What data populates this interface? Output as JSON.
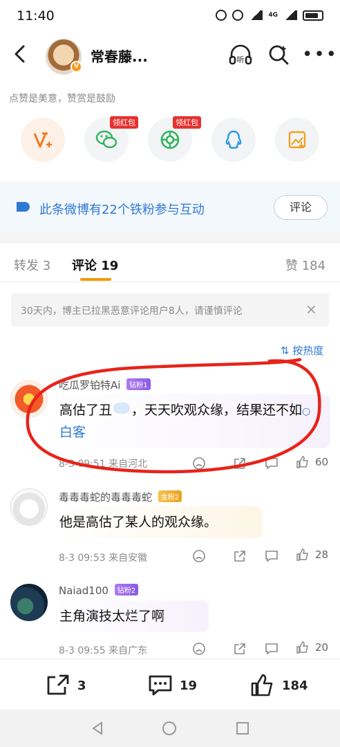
{
  "status_bar": {
    "time": "11:40",
    "network": "4G"
  },
  "header": {
    "title": "常春藤..."
  },
  "reward": {
    "hint": "点赞是美意，赞赏是鼓励",
    "tag_1": "领红包",
    "tag_2": "领红包"
  },
  "fans_banner": {
    "text": "此条微博有22个铁粉参与互动",
    "button": "评论"
  },
  "tabs": {
    "repost": "转发 3",
    "comment": "评论 19",
    "like": "赞 184"
  },
  "notice": {
    "text": "30天内，博主已拉黑恶意评论用户8人，请谨慎评论",
    "close": "×"
  },
  "sort": {
    "label": "按热度"
  },
  "comments": [
    {
      "username": "吃瓜罗铂特Ai",
      "badge": "钻粉1",
      "text_before": "高估了丑",
      "text_after": "，天天吹观众缘，结果还不如",
      "search_link": "白客",
      "time": "8-3 09:51",
      "location": "来自河北",
      "likes": "60"
    },
    {
      "username": "毒毒毒蛇的毒毒毒蛇",
      "badge": "金粉2",
      "text": "他是高估了某人的观众缘。",
      "time": "8-3 09:53",
      "location": "来自安徽",
      "likes": "28"
    },
    {
      "username": "Naiad100",
      "badge": "钻粉2",
      "text": "主角演技太烂了啊",
      "time": "8-3 09:55",
      "location": "来自广东",
      "likes": "20"
    }
  ],
  "bottom_bar": {
    "repost_count": "3",
    "comment_count": "19",
    "like_count": "184"
  },
  "colors": {
    "accent": "#f39800",
    "link": "#2f79d4",
    "annotation": "#e8231a"
  }
}
